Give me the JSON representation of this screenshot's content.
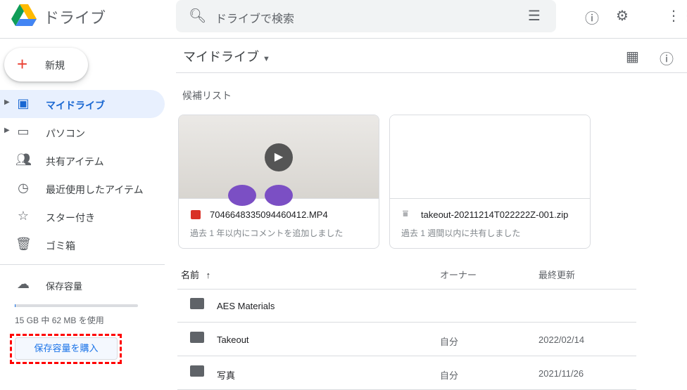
{
  "app": {
    "title": "ドライブ"
  },
  "search": {
    "placeholder": "ドライブで検索"
  },
  "new_button": "新規",
  "sidebar": {
    "items": [
      {
        "label": "マイドライブ",
        "icon": "drive-icon",
        "selected": true
      },
      {
        "label": "パソコン",
        "icon": "computer-icon"
      },
      {
        "label": "共有アイテム",
        "icon": "people-icon"
      },
      {
        "label": "最近使用したアイテム",
        "icon": "clock-icon"
      },
      {
        "label": "スター付き",
        "icon": "star-icon"
      },
      {
        "label": "ゴミ箱",
        "icon": "trash-icon"
      }
    ],
    "storage_label": "保存容量",
    "storage_usage": "15 GB 中 62 MB を使用",
    "storage_fraction": 0.004,
    "buy_storage": "保存容量を購入"
  },
  "main": {
    "title": "マイドライブ",
    "suggested": "候補リスト",
    "cards": [
      {
        "name": "7046648335094460412.MP4",
        "sub": "過去 1 年以内にコメントを追加しました"
      },
      {
        "name": "takeout-20211214T022222Z-001.zip",
        "sub": "過去 1 週間以内に共有しました"
      }
    ],
    "columns": {
      "name": "名前",
      "owner": "オーナー",
      "modified": "最終更新"
    },
    "files": [
      {
        "name": "AES Materials",
        "owner": "",
        "modified": ""
      },
      {
        "name": "Takeout",
        "owner": "自分",
        "modified": "2022/02/14"
      },
      {
        "name": "写真",
        "owner": "自分",
        "modified": "2021/11/26"
      }
    ]
  },
  "colors": {
    "accent": "#1967d2",
    "highlight": "#ff0000"
  }
}
